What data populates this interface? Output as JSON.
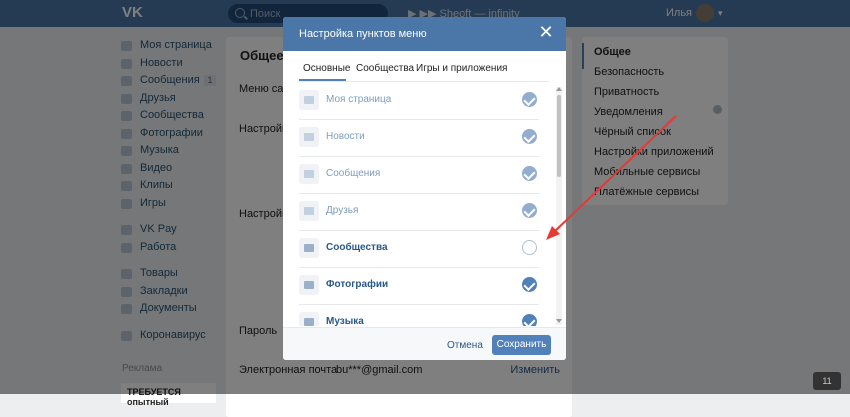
{
  "topbar": {
    "logo": "VK",
    "search_placeholder": "Поиск",
    "player_text": "▶ ▶▶  Sheoft — infinity",
    "user_name": "Илья",
    "brand_color": "#4a76a8"
  },
  "leftnav": {
    "items": [
      {
        "label": "Моя страница",
        "icon": "home-icon"
      },
      {
        "label": "Новости",
        "icon": "news-icon"
      },
      {
        "label": "Сообщения",
        "icon": "messages-icon",
        "badge": "1"
      },
      {
        "label": "Друзья",
        "icon": "friends-icon"
      },
      {
        "label": "Сообщества",
        "icon": "communities-icon"
      },
      {
        "label": "Фотографии",
        "icon": "photos-icon"
      },
      {
        "label": "Музыка",
        "icon": "music-icon"
      },
      {
        "label": "Видео",
        "icon": "video-icon"
      },
      {
        "label": "Клипы",
        "icon": "clips-icon"
      },
      {
        "label": "Игры",
        "icon": "games-icon"
      },
      {
        "label": "VK Pay",
        "icon": "vkpay-icon"
      },
      {
        "label": "Работа",
        "icon": "work-icon"
      },
      {
        "label": "Товары",
        "icon": "goods-icon"
      },
      {
        "label": "Закладки",
        "icon": "bookmarks-icon"
      },
      {
        "label": "Документы",
        "icon": "documents-icon"
      },
      {
        "label": "Коронавирус",
        "icon": "coronavirus-icon"
      }
    ],
    "ads_label": "Реклама",
    "ad_text": "ТРЕБУЕТСЯ опытный"
  },
  "main": {
    "title": "Общее",
    "rows": [
      {
        "label": "Меню сайта"
      },
      {
        "label": "Настройки"
      },
      {
        "label": "Настройки"
      },
      {
        "label": "Пароль"
      },
      {
        "label": "Электронная почта",
        "value": "bu***@gmail.com",
        "action": "Изменить"
      }
    ]
  },
  "rightnav": {
    "items": [
      "Общее",
      "Безопасность",
      "Приватность",
      "Уведомления",
      "Чёрный список",
      "Настройки приложений",
      "Мобильные сервисы",
      "Платёжные сервисы"
    ]
  },
  "modal": {
    "title": "Настройка пунктов меню",
    "close": "✕",
    "tabs": [
      "Основные",
      "Сообщества",
      "Игры и приложения"
    ],
    "items": [
      {
        "label": "Моя страница",
        "icon": "home-icon",
        "state": "locked"
      },
      {
        "label": "Новости",
        "icon": "news-icon",
        "state": "locked"
      },
      {
        "label": "Сообщения",
        "icon": "messages-icon",
        "state": "locked"
      },
      {
        "label": "Друзья",
        "icon": "friends-icon",
        "state": "locked"
      },
      {
        "label": "Сообщества",
        "icon": "communities-icon",
        "state": "unchecked"
      },
      {
        "label": "Фотографии",
        "icon": "photos-icon",
        "state": "checked"
      },
      {
        "label": "Музыка",
        "icon": "music-icon",
        "state": "checked"
      }
    ],
    "cancel_label": "Отмена",
    "save_label": "Сохранить"
  },
  "corner_badge": "11",
  "arrow_color": "#e53935"
}
